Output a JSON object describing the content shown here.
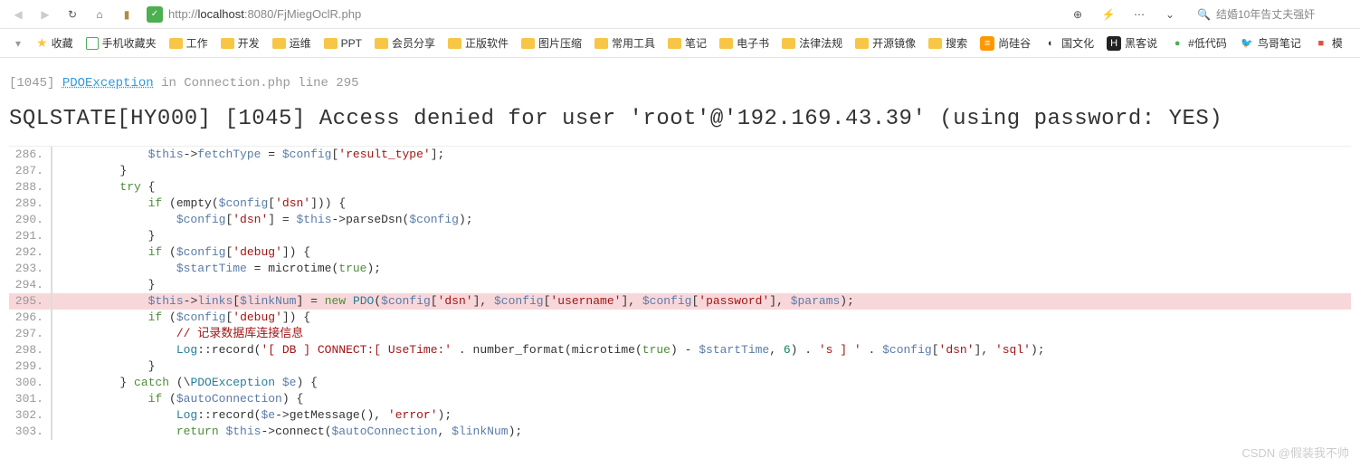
{
  "toolbar": {
    "url_prefix": "http://",
    "url_host": "localhost",
    "url_port": ":8080",
    "url_path": "/FjMiegOclR.php",
    "search_placeholder": "结婚10年告丈夫强奸"
  },
  "bookmarks": [
    {
      "label": "收藏",
      "type": "star"
    },
    {
      "label": "手机收藏夹",
      "type": "green"
    },
    {
      "label": "工作",
      "type": "folder"
    },
    {
      "label": "开发",
      "type": "folder"
    },
    {
      "label": "运维",
      "type": "folder"
    },
    {
      "label": "PPT",
      "type": "folder"
    },
    {
      "label": "会员分享",
      "type": "folder"
    },
    {
      "label": "正版软件",
      "type": "folder"
    },
    {
      "label": "图片压缩",
      "type": "folder"
    },
    {
      "label": "常用工具",
      "type": "folder"
    },
    {
      "label": "笔记",
      "type": "folder"
    },
    {
      "label": "电子书",
      "type": "folder"
    },
    {
      "label": "法律法规",
      "type": "folder"
    },
    {
      "label": "开源镜像",
      "type": "folder"
    },
    {
      "label": "搜索",
      "type": "folder"
    },
    {
      "label": "尚硅谷",
      "type": "custom",
      "icon": "≡",
      "bg": "#ff9800",
      "fg": "#fff"
    },
    {
      "label": "国文化",
      "type": "custom",
      "icon": "◐",
      "bg": "#fff",
      "fg": "#333"
    },
    {
      "label": "黑客说",
      "type": "custom",
      "icon": "H",
      "bg": "#222",
      "fg": "#fff"
    },
    {
      "label": "#低代码",
      "type": "custom",
      "icon": "●",
      "bg": "#fff",
      "fg": "#4caf50"
    },
    {
      "label": "鸟哥笔记",
      "type": "custom",
      "icon": "🐦",
      "bg": "#fff",
      "fg": "#333"
    },
    {
      "label": "模",
      "type": "custom",
      "icon": "■",
      "bg": "#fff",
      "fg": "#e74c3c"
    }
  ],
  "error": {
    "code_bracket": "[1045]",
    "exception": "PDOException",
    "location_text": " in Connection.php line 295",
    "in_word": "in",
    "file": "Connection.php",
    "line_word": "line",
    "line_no": "295",
    "title": "SQLSTATE[HY000] [1045] Access denied for user 'root'@'192.169.43.39' (using password: YES)"
  },
  "code": {
    "highlight_line": 295,
    "lines": [
      {
        "n": 286,
        "html": "            <span class='var'>$this</span>-><span class='prop'>fetchType</span> = <span class='var'>$config</span>[<span class='str'>'result_type'</span>];"
      },
      {
        "n": 287,
        "html": "        }"
      },
      {
        "n": 288,
        "html": "        <span class='kw'>try</span> {"
      },
      {
        "n": 289,
        "html": "            <span class='kw'>if</span> (<span class='fn'>empty</span>(<span class='var'>$config</span>[<span class='str'>'dsn'</span>])) {"
      },
      {
        "n": 290,
        "html": "                <span class='var'>$config</span>[<span class='str'>'dsn'</span>] = <span class='var'>$this</span>-><span class='fn'>parseDsn</span>(<span class='var'>$config</span>);"
      },
      {
        "n": 291,
        "html": "            }"
      },
      {
        "n": 292,
        "html": "            <span class='kw'>if</span> (<span class='var'>$config</span>[<span class='str'>'debug'</span>]) {"
      },
      {
        "n": 293,
        "html": "                <span class='var'>$startTime</span> = <span class='fn'>microtime</span>(<span class='kw'>true</span>);"
      },
      {
        "n": 294,
        "html": "            }"
      },
      {
        "n": 295,
        "html": "            <span class='var'>$this</span>-><span class='prop'>links</span>[<span class='var'>$linkNum</span>] = <span class='kw'>new</span> <span class='cls'>PDO</span>(<span class='var'>$config</span>[<span class='str'>'dsn'</span>], <span class='var'>$config</span>[<span class='str'>'username'</span>], <span class='var'>$config</span>[<span class='str'>'password'</span>], <span class='var'>$params</span>);"
      },
      {
        "n": 296,
        "html": "            <span class='kw'>if</span> (<span class='var'>$config</span>[<span class='str'>'debug'</span>]) {"
      },
      {
        "n": 297,
        "html": "                <span class='cmt'>// 记录数据库连接信息</span>"
      },
      {
        "n": 298,
        "html": "                <span class='cls'>Log</span>::<span class='fn'>record</span>(<span class='str'>'[ DB ] CONNECT:[ UseTime:'</span> . <span class='fn'>number_format</span>(<span class='fn'>microtime</span>(<span class='kw'>true</span>) - <span class='var'>$startTime</span>, <span class='num'>6</span>) . <span class='str'>'s ] '</span> . <span class='var'>$config</span>[<span class='str'>'dsn'</span>], <span class='str'>'sql'</span>);"
      },
      {
        "n": 299,
        "html": "            }"
      },
      {
        "n": 300,
        "html": "        } <span class='kw'>catch</span> (\\<span class='cls'>PDOException</span> <span class='var'>$e</span>) {"
      },
      {
        "n": 301,
        "html": "            <span class='kw'>if</span> (<span class='var'>$autoConnection</span>) {"
      },
      {
        "n": 302,
        "html": "                <span class='cls'>Log</span>::<span class='fn'>record</span>(<span class='var'>$e</span>-><span class='fn'>getMessage</span>(), <span class='str'>'error'</span>);"
      },
      {
        "n": 303,
        "html": "                <span class='kw'>return</span> <span class='var'>$this</span>-><span class='fn'>connect</span>(<span class='var'>$autoConnection</span>, <span class='var'>$linkNum</span>);"
      }
    ]
  },
  "watermark": "CSDN @假装我不帅"
}
